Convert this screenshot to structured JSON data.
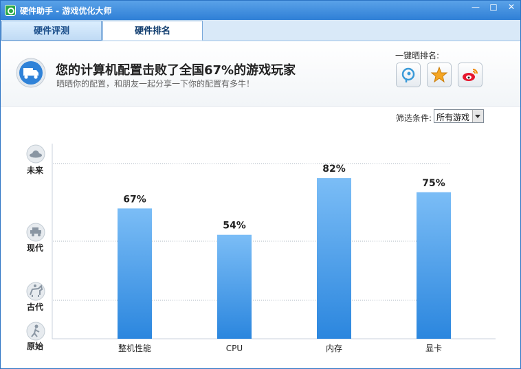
{
  "window": {
    "title": "硬件助手 - 游戏优化大师",
    "controls": {
      "minimize": "—",
      "maximize": "□",
      "close": "✕"
    }
  },
  "tabs": [
    {
      "label": "硬件评测",
      "active": false
    },
    {
      "label": "硬件排名",
      "active": true
    }
  ],
  "header": {
    "headline": "您的计算机配置击败了全国67%的游戏玩家",
    "subline": "晒晒你的配置，和朋友一起分享一下你的配置有多牛！",
    "share_label": "一键晒排名:",
    "share_buttons": [
      {
        "icon": "qq-space-icon"
      },
      {
        "icon": "star-icon"
      },
      {
        "icon": "weibo-icon"
      }
    ]
  },
  "filter": {
    "label": "筛选条件:",
    "value": "所有游戏"
  },
  "chart_data": {
    "type": "bar",
    "categories": [
      "整机性能",
      "CPU",
      "内存",
      "显卡"
    ],
    "values": [
      67,
      54,
      82,
      75
    ],
    "value_labels": [
      "67%",
      "54%",
      "82%",
      "75%"
    ],
    "ylim": [
      0,
      100
    ],
    "levels": [
      "未来",
      "现代",
      "古代",
      "原始"
    ],
    "level_icons": [
      "ufo-icon",
      "car-icon",
      "horse-rider-icon",
      "caveman-icon"
    ],
    "bar_color_top": "#7bbdf6",
    "bar_color_bottom": "#2b86de"
  }
}
